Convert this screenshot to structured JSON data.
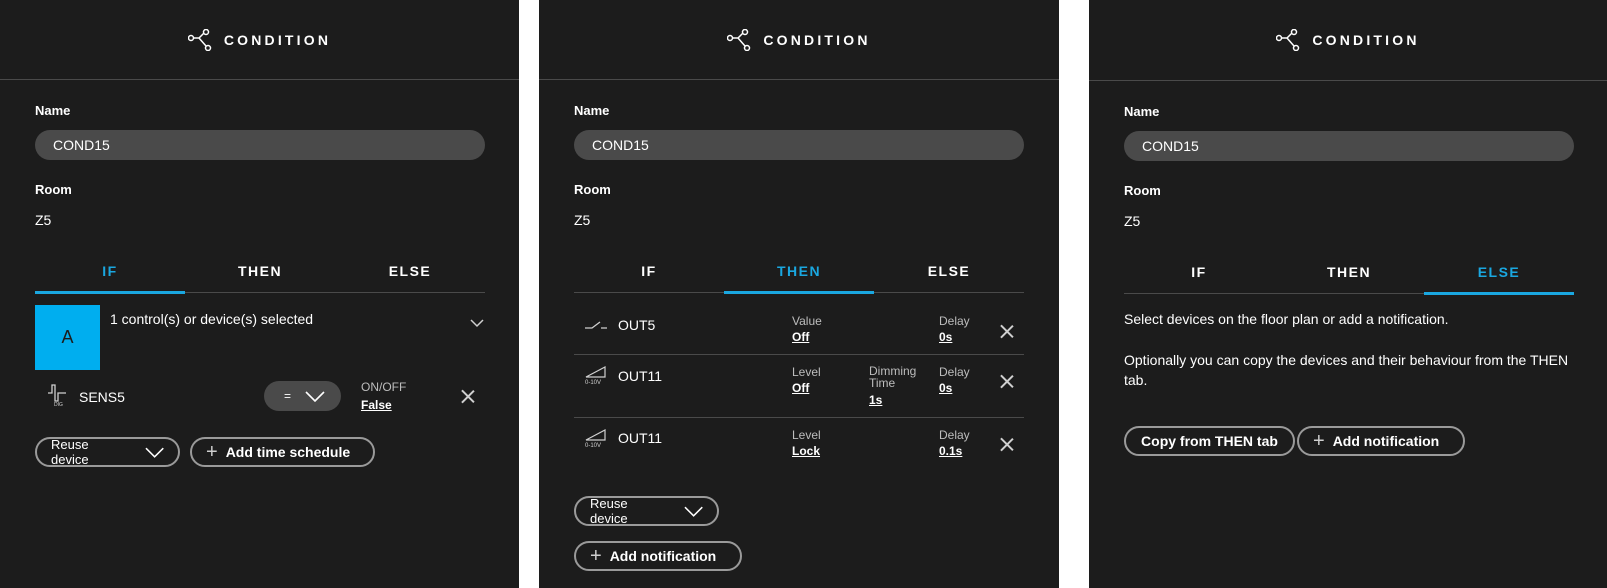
{
  "header": {
    "title": "CONDITION",
    "icon": "branch-icon"
  },
  "form": {
    "name_label": "Name",
    "name_value": "COND15",
    "room_label": "Room",
    "room_value": "Z5"
  },
  "tabs": [
    "IF",
    "THEN",
    "ELSE"
  ],
  "accent": "#1aa7e0",
  "if_panel": {
    "group_letter": "A",
    "selection_text": "1 control(s) or device(s) selected",
    "device": {
      "name": "SENS5",
      "operator": "=",
      "prop_label": "ON/OFF",
      "prop_value": "False"
    },
    "reuse_label": "Reuse device",
    "add_label": "Add time schedule"
  },
  "then_panel": {
    "rows": [
      {
        "name": "OUT5",
        "icon": "switch-icon",
        "c1_label": "Value",
        "c1_value": "Off",
        "c2_label": "",
        "c2_value": "",
        "delay_label": "Delay",
        "delay_value": "0s"
      },
      {
        "name": "OUT11",
        "icon": "dimmer-0-10v-icon",
        "c1_label": "Level",
        "c1_value": "Off",
        "c2_label": "Dimming Time",
        "c2_value": "1s",
        "delay_label": "Delay",
        "delay_value": "0s"
      },
      {
        "name": "OUT11",
        "icon": "dimmer-0-10v-icon",
        "c1_label": "Level",
        "c1_value": "Lock",
        "c2_label": "",
        "c2_value": "",
        "delay_label": "Delay",
        "delay_value": "0.1s"
      }
    ],
    "reuse_label": "Reuse device",
    "add_label": "Add notification"
  },
  "else_panel": {
    "text1": "Select devices on the floor plan or add a notification.",
    "text2": "Optionally you can copy the devices and their behaviour from the THEN tab.",
    "copy_label": "Copy from THEN tab",
    "add_label": "Add notification"
  }
}
